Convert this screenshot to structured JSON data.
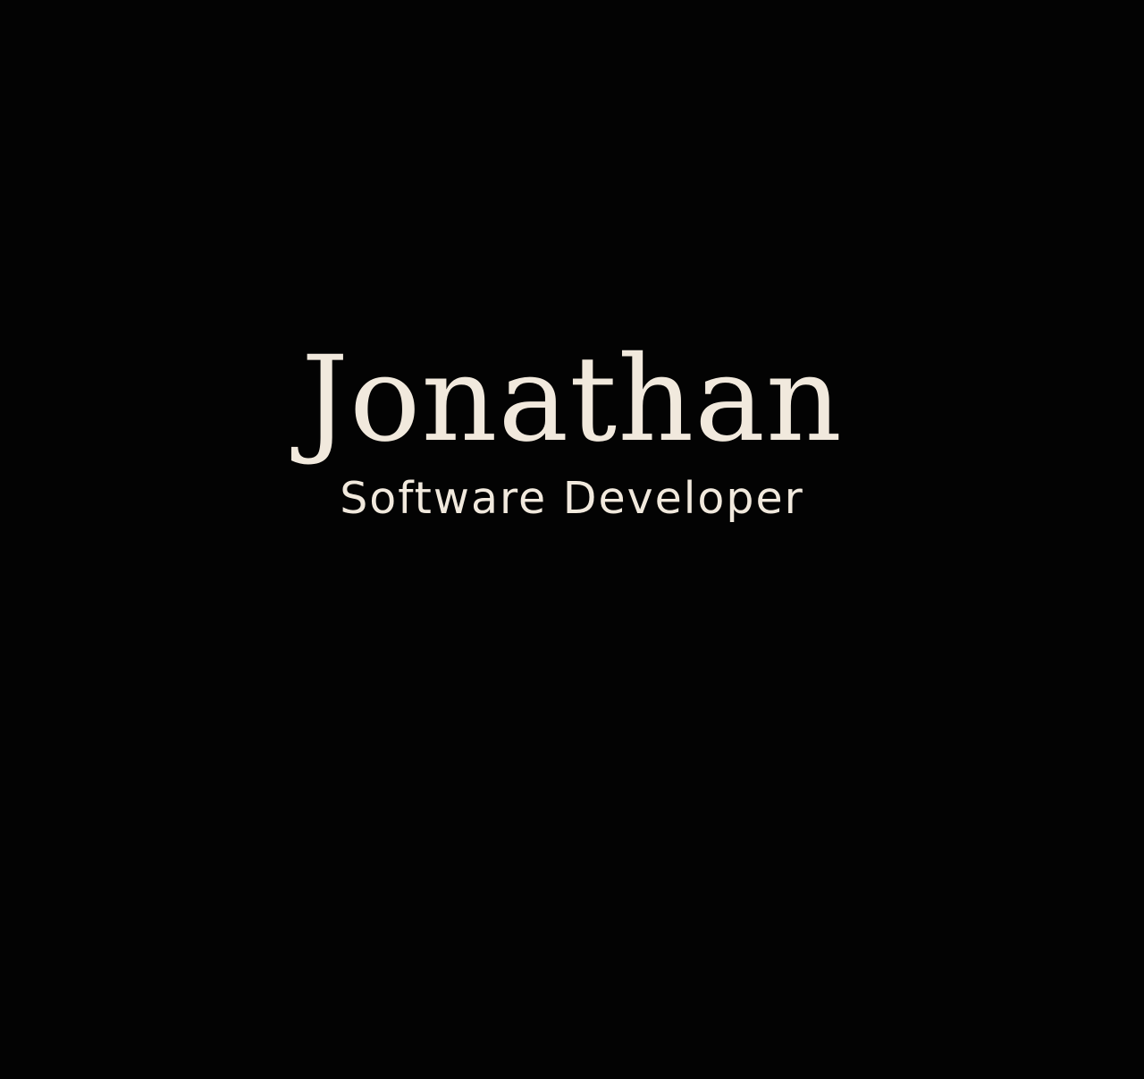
{
  "hero": {
    "name": "Jonathan",
    "role": "Software Developer"
  },
  "colors": {
    "background": "#030303",
    "text": "#f1e9dd"
  }
}
